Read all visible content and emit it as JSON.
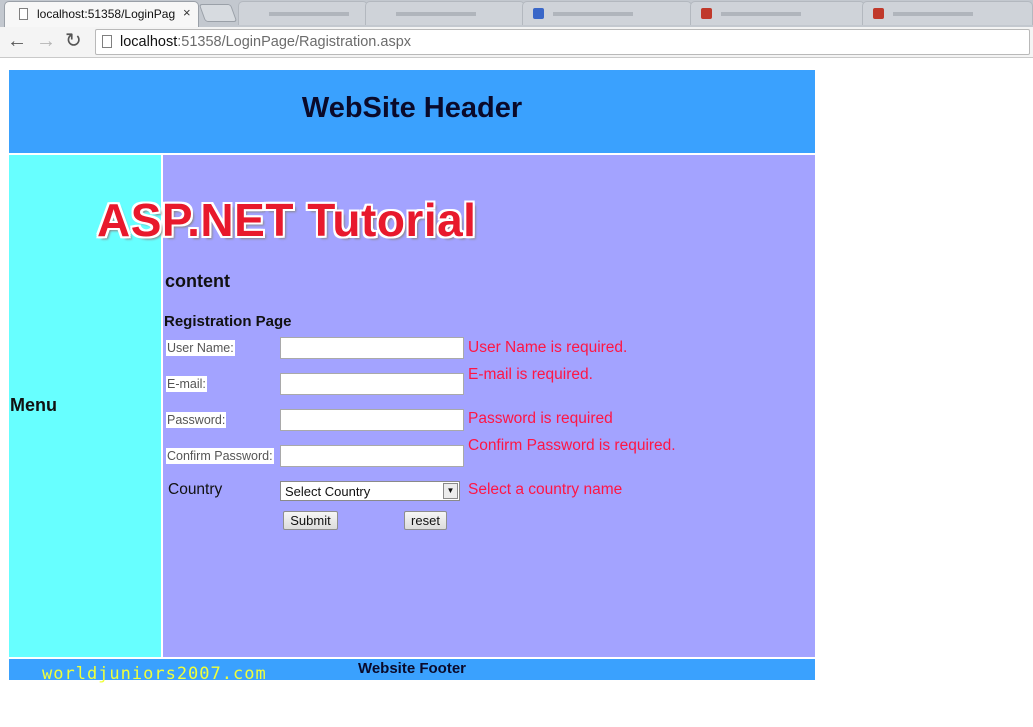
{
  "browser": {
    "tab_title": "localhost:51358/LoginPag",
    "tab_close": "×",
    "url_host": "localhost",
    "url_rest": ":51358/LoginPage/Ragistration.aspx",
    "back_glyph": "←",
    "forward_glyph": "→",
    "reload_glyph": "↻"
  },
  "header": {
    "title": "WebSite Header"
  },
  "menu": {
    "label": "Menu"
  },
  "banner": {
    "text": "ASP.NET Tutorial"
  },
  "content": {
    "heading": "content",
    "page_title": "Registration Page"
  },
  "form": {
    "username_label": "User Name:",
    "username_value": "",
    "username_error": "User Name is required.",
    "email_label": "E-mail:",
    "email_value": "",
    "email_error": "E-mail is required.",
    "password_label": "Password:",
    "password_value": "",
    "password_error": "Password is required",
    "confirm_label": "Confirm Password:",
    "confirm_value": "",
    "confirm_error": "Confirm Password is required.",
    "country_label": "Country",
    "country_selected": "Select Country",
    "country_error": "Select a country name",
    "submit_label": "Submit",
    "reset_label": "reset"
  },
  "footer": {
    "text": "Website Footer"
  },
  "watermark": {
    "text": "worldjuniors2007.com"
  },
  "colors": {
    "header_bg": "#3aa1fe",
    "menu_bg": "#67ffff",
    "content_bg": "#a3a3ff",
    "error": "#ff1544",
    "banner": "#e8192c"
  }
}
